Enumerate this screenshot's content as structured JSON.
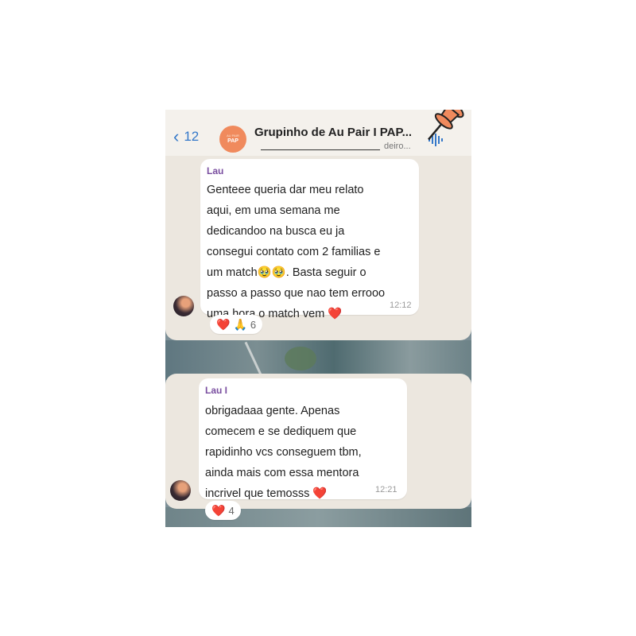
{
  "header": {
    "back_label": "12",
    "group_avatar_text": "AU PAIR",
    "group_avatar_small": "PAP",
    "title": "Grupinho de Au Pair I PAP...",
    "subtitle": "deiro..."
  },
  "messages": [
    {
      "sender": "Lau",
      "lines": [
        "Genteee queria dar meu relato",
        "aqui, em uma semana me",
        "dedicandoo na busca eu ja",
        "consegui contato com 2 familias e",
        "um match🥹🥹. Basta seguir o",
        "passo a passo que nao tem errooo",
        "uma hora o match vem ❤️"
      ],
      "time": "12:12",
      "reactions": {
        "emojis": [
          "❤️",
          "🙏"
        ],
        "count": "6"
      }
    },
    {
      "sender": "Lau I",
      "lines": [
        "obrigadaaa gente. Apenas",
        "comecem e se dediquem que",
        "rapidinho vcs conseguem tbm,",
        "ainda mais com essa mentora",
        "incrivel que temosss ❤️"
      ],
      "time": "12:21",
      "reactions": {
        "emojis": [
          "❤️"
        ],
        "count": "4"
      }
    }
  ],
  "colors": {
    "accent": "#3478c9",
    "sender": "#7a4fa0",
    "pin": "#f08a5d",
    "heart": "#e0242e"
  }
}
